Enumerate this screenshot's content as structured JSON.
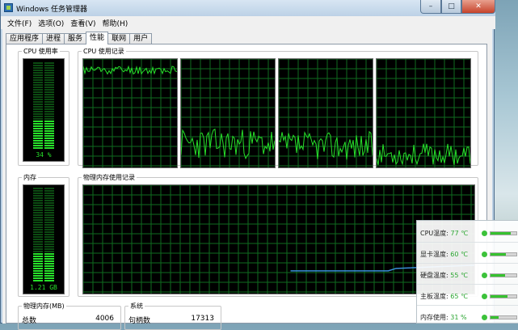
{
  "window": {
    "title": "Windows 任务管理器",
    "minimize": "–",
    "maximize": "□",
    "close": "✕"
  },
  "menu": [
    "文件(F)",
    "选项(O)",
    "查看(V)",
    "帮助(H)"
  ],
  "tabs": [
    {
      "label": "应用程序",
      "active": false
    },
    {
      "label": "进程",
      "active": false
    },
    {
      "label": "服务",
      "active": false
    },
    {
      "label": "性能",
      "active": true
    },
    {
      "label": "联网",
      "active": false
    },
    {
      "label": "用户",
      "active": false
    }
  ],
  "cpu_usage": {
    "label": "CPU 使用率",
    "value": "34 %",
    "percent": 34
  },
  "cpu_history": {
    "label": "CPU 使用记录"
  },
  "memory": {
    "label": "内存",
    "value": "1.21 GB",
    "percent": 31
  },
  "memory_history": {
    "label": "物理内存使用记录"
  },
  "physical_memory": {
    "label": "物理内存(MB)",
    "total_label": "总数",
    "total_value": "4006"
  },
  "system": {
    "label": "系统",
    "handles_label": "句柄数",
    "handles_value": "17313"
  },
  "colors": {
    "graph_line": "#27e02a",
    "grid": "#0f6b1f",
    "memory_line": "#3a8fd9"
  },
  "sensors": [
    {
      "label": "CPU温度:",
      "value": "77 ℃",
      "level": 0.77
    },
    {
      "label": "显卡温度:",
      "value": "60 ℃",
      "level": 0.6
    },
    {
      "label": "硬盘温度:",
      "value": "55 ℃",
      "level": 0.55
    },
    {
      "label": "主板温度:",
      "value": "65 ℃",
      "level": 0.65
    },
    {
      "label": "内存使用:",
      "value": "31 %",
      "level": 0.31
    }
  ]
}
